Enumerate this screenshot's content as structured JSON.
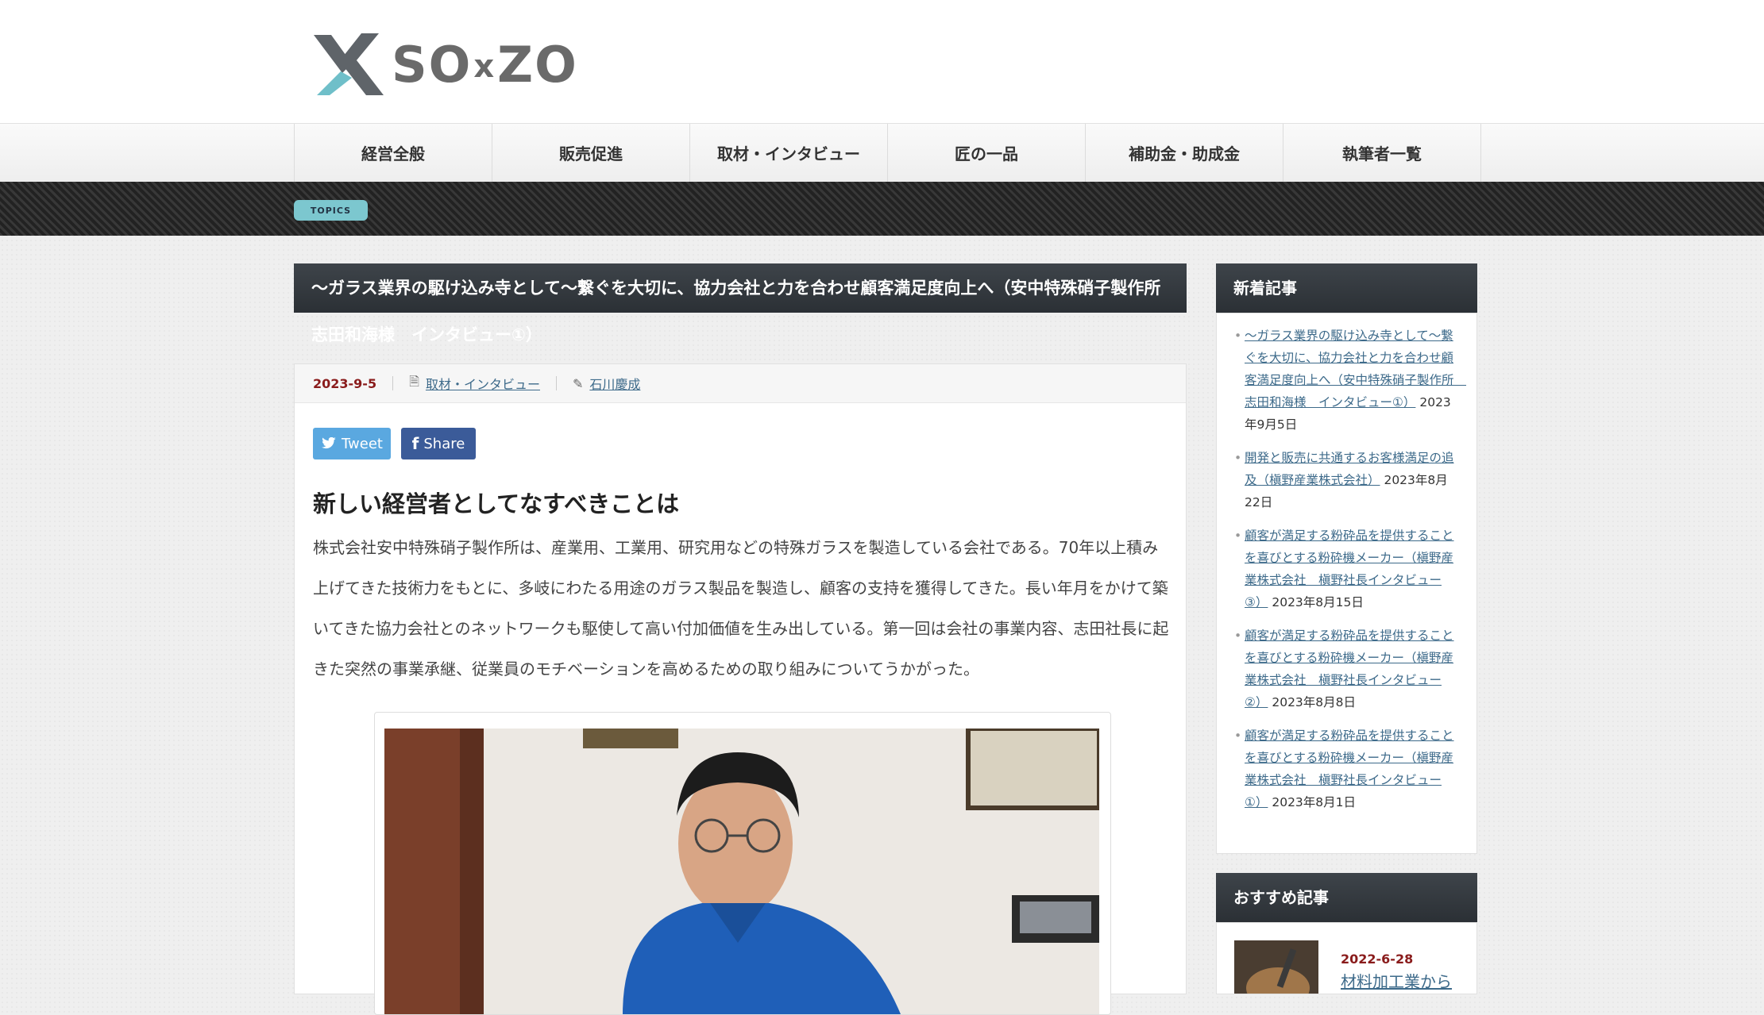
{
  "brand": {
    "logo_text_1": "SO",
    "logo_x": "x",
    "logo_text_2": "ZO",
    "colors": {
      "mark_gray": "#5f6469",
      "mark_teal": "#6fbfc9"
    }
  },
  "nav": {
    "items": [
      "経営全般",
      "販売促進",
      "取材・インタビュー",
      "匠の一品",
      "補助金・助成金",
      "執筆者一覧"
    ]
  },
  "topics_badge": "TOPICS",
  "article": {
    "title": "～ガラス業界の駆け込み寺として～繋ぐを大切に、協力会社と力を合わせ顧客満足度向上へ（安中特殊硝子製作所",
    "title_overflow": "志田和海様　インタビュー①）",
    "date": "2023-9-5",
    "category": "取材・インタビュー",
    "author": "石川慶成",
    "tweet_label": "Tweet",
    "share_label": "Share",
    "heading": "新しい経営者としてなすべきことは",
    "lead": "株式会社安中特殊硝子製作所は、産業用、工業用、研究用などの特殊ガラスを製造している会社である。70年以上積み上げてきた技術力をもとに、多岐にわたる用途のガラス製品を製造し、顧客の支持を獲得してきた。長い年月をかけて築いてきた協力会社とのネットワークも駆使して高い付加価値を生み出している。第一回は会社の事業内容、志田社長に起きた突然の事業承継、従業員のモチベーションを高めるための取り組みについてうかがった。"
  },
  "sidebar": {
    "new_heading": "新着記事",
    "new_items": [
      {
        "title": "～ガラス業界の駆け込み寺として～繋ぐを大切に、協力会社と力を合わせ顧客満足度向上へ（安中特殊硝子製作所　志田和海様　インタビュー①）",
        "date": "2023年9月5日"
      },
      {
        "title": "開発と販売に共通するお客様満足の追及（槇野産業株式会社）",
        "date": "2023年8月22日"
      },
      {
        "title": "顧客が満足する粉砕品を提供することを喜びとする粉砕機メーカー（槇野産業株式会社　槇野社長インタビュー③）",
        "date": "2023年8月15日"
      },
      {
        "title": "顧客が満足する粉砕品を提供することを喜びとする粉砕機メーカー（槇野産業株式会社　槇野社長インタビュー②）",
        "date": "2023年8月8日"
      },
      {
        "title": "顧客が満足する粉砕品を提供することを喜びとする粉砕機メーカー（槇野産業株式会社　槇野社長インタビュー①）",
        "date": "2023年8月1日"
      }
    ],
    "rec_heading": "おすすめ記事",
    "rec_date": "2022-6-28",
    "rec_title": "材料加工業から"
  }
}
